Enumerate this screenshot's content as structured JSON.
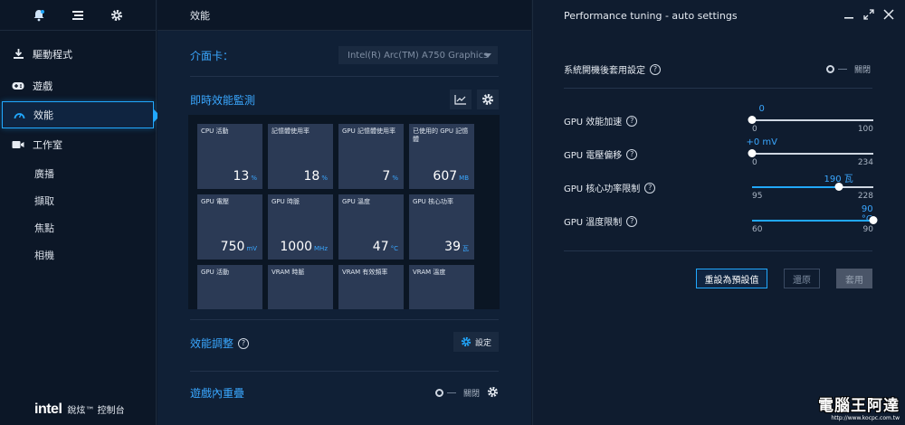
{
  "sidebar": {
    "top_icons": [
      "bell-icon",
      "list-icon",
      "gear-icon"
    ],
    "items": [
      {
        "label": "驅動程式",
        "icon": "download-icon"
      },
      {
        "label": "遊戲",
        "icon": "gamepad-icon"
      },
      {
        "label": "效能",
        "icon": "gauge-icon",
        "active": true
      },
      {
        "label": "工作室",
        "icon": "camera-icon"
      }
    ],
    "subitems": [
      "廣播",
      "擷取",
      "焦點",
      "相機"
    ],
    "brand": {
      "logo": "intel",
      "text": "銳炫™ 控制台"
    }
  },
  "mid": {
    "header": "效能",
    "gpu_label": "介面卡：",
    "gpu_value": "Intel(R) Arc(TM) A750 Graphics",
    "monitor_title": "即時效能監測",
    "tiles": [
      {
        "label": "CPU 活動",
        "value": "13",
        "unit": "%"
      },
      {
        "label": "記憶體使用率",
        "value": "18",
        "unit": "%"
      },
      {
        "label": "GPU 記憶體使用率",
        "value": "7",
        "unit": "%"
      },
      {
        "label": "已使用的 GPU 記憶體",
        "value": "607",
        "unit": "MB"
      },
      {
        "label": "GPU 電壓",
        "value": "750",
        "unit": "mV"
      },
      {
        "label": "GPU 時脈",
        "value": "1000",
        "unit": "MHz"
      },
      {
        "label": "GPU 溫度",
        "value": "47",
        "unit": "°C"
      },
      {
        "label": "GPU 核心功率",
        "value": "39",
        "unit": "瓦"
      },
      {
        "label": "GPU 活動",
        "value": "",
        "unit": ""
      },
      {
        "label": "VRAM 時脈",
        "value": "",
        "unit": ""
      },
      {
        "label": "VRAM 有效頻率",
        "value": "",
        "unit": ""
      },
      {
        "label": "VRAM 溫度",
        "value": "",
        "unit": ""
      }
    ],
    "tuning_title": "效能調整",
    "tuning_button": "設定",
    "overlay_title": "遊戲內重疊",
    "overlay_state": "關閉"
  },
  "right": {
    "header": "Performance tuning - auto settings",
    "apply_on_boot": {
      "label": "系統開機後套用設定",
      "state": "關閉"
    },
    "sliders": [
      {
        "label": "GPU 效能加速",
        "value": "0",
        "min": "0",
        "max": "100",
        "fraction": 0.0
      },
      {
        "label": "GPU 電壓偏移",
        "value": "+0 mV",
        "min": "0",
        "max": "234",
        "fraction": 0.0
      },
      {
        "label": "GPU 核心功率限制",
        "value": "190 瓦",
        "min": "95",
        "max": "228",
        "fraction": 0.714
      },
      {
        "label": "GPU 溫度限制",
        "value": "90 °C",
        "min": "60",
        "max": "90",
        "fraction": 1.0
      }
    ],
    "buttons": {
      "reset": "重設為預設值",
      "revert": "還原",
      "apply": "套用"
    }
  },
  "watermark": {
    "title": "電腦王阿達",
    "url": "http://www.kocpc.com.tw"
  },
  "colors": {
    "accent": "#21a8ff",
    "background": "#0e1a2b",
    "tile": "#2b3a55"
  }
}
